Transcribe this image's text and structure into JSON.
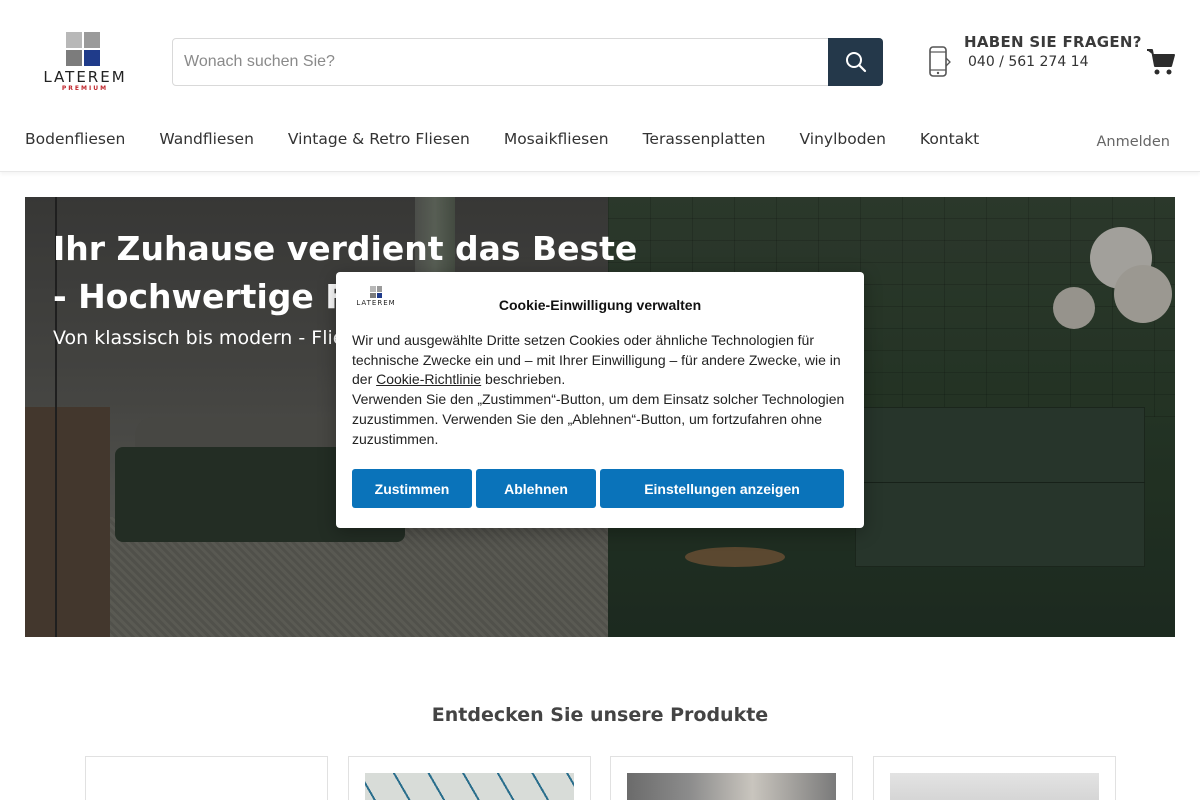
{
  "brand": {
    "name": "LATEREM",
    "subtitle": "PREMIUM",
    "colors": {
      "accent": "#1f3b8a",
      "red": "#c0272d"
    }
  },
  "search": {
    "placeholder": "Wonach suchen Sie?",
    "icon": "search-icon",
    "button_color": "#24384a"
  },
  "contact": {
    "title": "HABEN SIE FRAGEN?",
    "phone": "040 / 561 274 14",
    "icon": "phone-icon"
  },
  "cart": {
    "icon": "cart-icon"
  },
  "nav": {
    "items": [
      {
        "label": "Bodenfliesen"
      },
      {
        "label": "Wandfliesen"
      },
      {
        "label": "Vintage & Retro Fliesen"
      },
      {
        "label": "Mosaikfliesen"
      },
      {
        "label": "Terassenplatten"
      },
      {
        "label": "Vinylboden"
      },
      {
        "label": "Kontakt"
      }
    ],
    "login": "Anmelden"
  },
  "hero": {
    "title": "Ihr Zuhause verdient das Beste - Hochwertige Fliesen",
    "subtitle": "Von klassisch bis modern - Fliesen"
  },
  "products": {
    "title": "Entdecken Sie unsere Produkte"
  },
  "cookie": {
    "title": "Cookie-Einwilligung verwalten",
    "text_1": "Wir und ausgewählte Dritte setzen Cookies oder ähnliche Technologien für technische Zwecke ein und – mit Ihrer Einwilligung – für andere Zwecke, wie in der ",
    "link": "Cookie-Richtlinie",
    "text_2": " beschrieben.",
    "text_3": "Verwenden Sie den „Zustimmen“-Button, um dem Einsatz solcher Technologien zuzustimmen. Verwenden Sie den „Ablehnen“-Button, um fortzufahren ohne zuzustimmen.",
    "accept": "Zustimmen",
    "deny": "Ablehnen",
    "settings": "Einstellungen anzeigen",
    "button_color": "#0a73ba"
  }
}
